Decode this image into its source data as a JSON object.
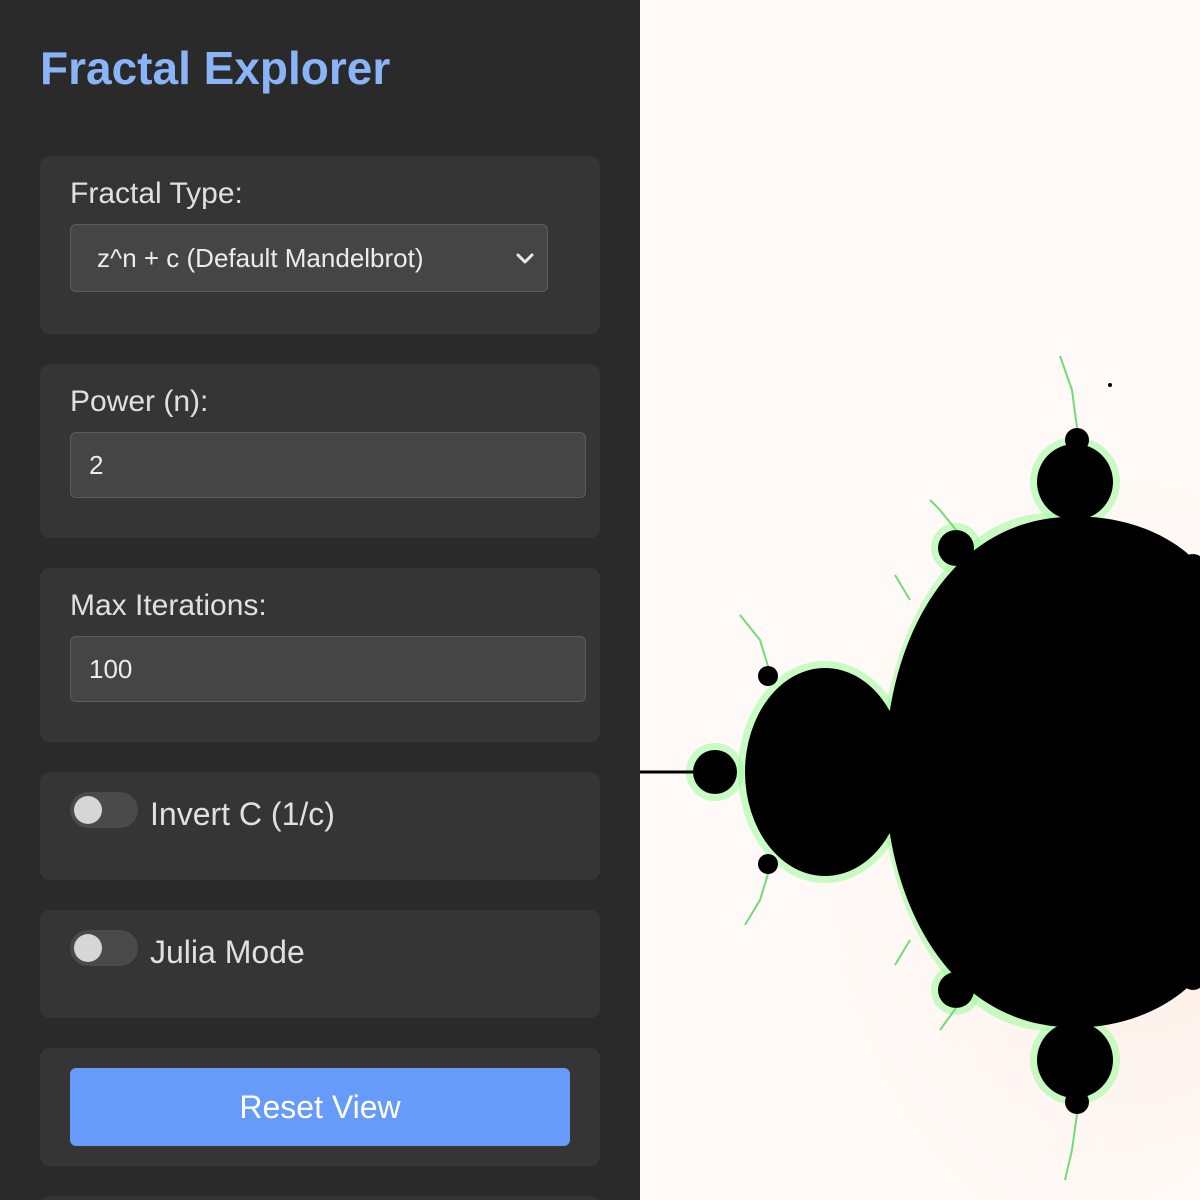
{
  "app": {
    "title": "Fractal Explorer"
  },
  "controls": {
    "fractal_type": {
      "label": "Fractal Type:",
      "selected": "z^n + c (Default Mandelbrot)"
    },
    "power": {
      "label": "Power (n):",
      "value": "2"
    },
    "max_iterations": {
      "label": "Max Iterations:",
      "value": "100"
    },
    "invert_c": {
      "label": "Invert C (1/c)",
      "checked": false
    },
    "julia_mode": {
      "label": "Julia Mode",
      "checked": false
    },
    "reset": {
      "label": "Reset View"
    }
  },
  "colors": {
    "accent": "#8ab4f8",
    "button": "#669bfa",
    "panel": "#353535",
    "sidebar": "#2a2a2a",
    "canvas_background": "#fffaf8",
    "set_fill": "#000000",
    "edge_glow": "#9dfc9a"
  },
  "icons": {
    "select_arrow": "chevron-down-icon"
  },
  "canvas": {
    "content": "Mandelbrot set render"
  }
}
